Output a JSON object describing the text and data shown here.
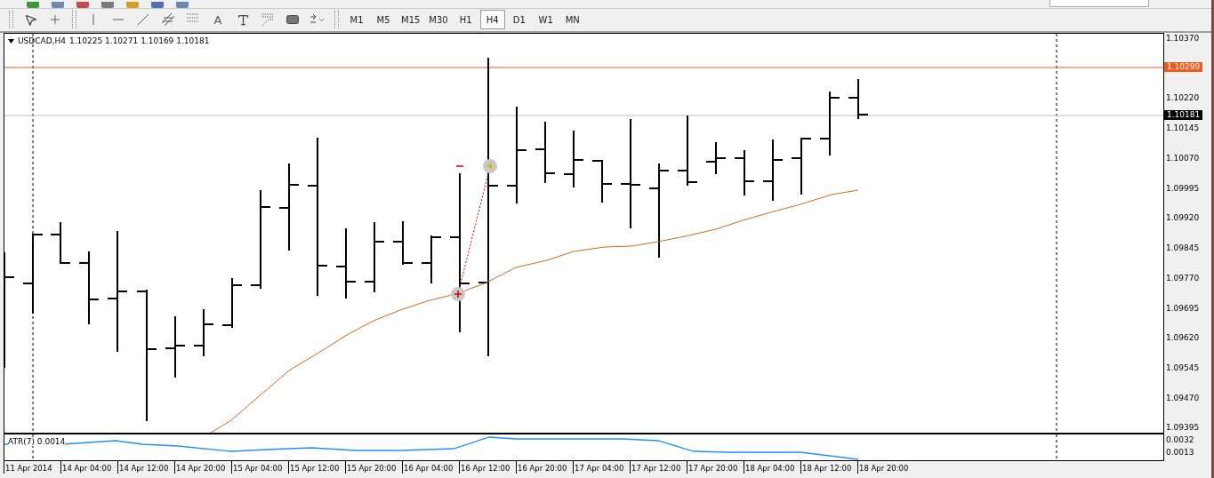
{
  "toolbar": {
    "text_tool": "A",
    "timeframes": [
      {
        "label": "M1",
        "selected": false
      },
      {
        "label": "M5",
        "selected": false
      },
      {
        "label": "M15",
        "selected": false
      },
      {
        "label": "M30",
        "selected": false
      },
      {
        "label": "H1",
        "selected": false
      },
      {
        "label": "H4",
        "selected": true
      },
      {
        "label": "D1",
        "selected": false
      },
      {
        "label": "W1",
        "selected": false
      },
      {
        "label": "MN",
        "selected": false
      }
    ]
  },
  "chart": {
    "symbol": "USDCAD,H4",
    "quote": "1.10225 1.10271 1.10169 1.10181",
    "price_ticks": [
      "1.10370",
      "1.10220",
      "1.10145",
      "1.10070",
      "1.09995",
      "1.09920",
      "1.09845",
      "1.09770",
      "1.09695",
      "1.09620",
      "1.09545",
      "1.09470",
      "1.09395"
    ],
    "price_markers": [
      {
        "label": "1.10299",
        "kind": "level"
      },
      {
        "label": "1.10181",
        "kind": "bid"
      }
    ],
    "indicator": {
      "label": "ATR(7) 0.0014",
      "ticks": [
        "0.0032",
        "0.0013"
      ]
    },
    "time_labels": [
      "11 Apr 2014",
      "14 Apr 04:00",
      "14 Apr 12:00",
      "14 Apr 20:00",
      "15 Apr 04:00",
      "15 Apr 12:00",
      "15 Apr 20:00",
      "16 Apr 04:00",
      "16 Apr 12:00",
      "16 Apr 20:00",
      "17 Apr 04:00",
      "17 Apr 12:00",
      "17 Apr 20:00",
      "18 Apr 04:00",
      "18 Apr 12:00",
      "18 Apr 20:00"
    ]
  }
}
